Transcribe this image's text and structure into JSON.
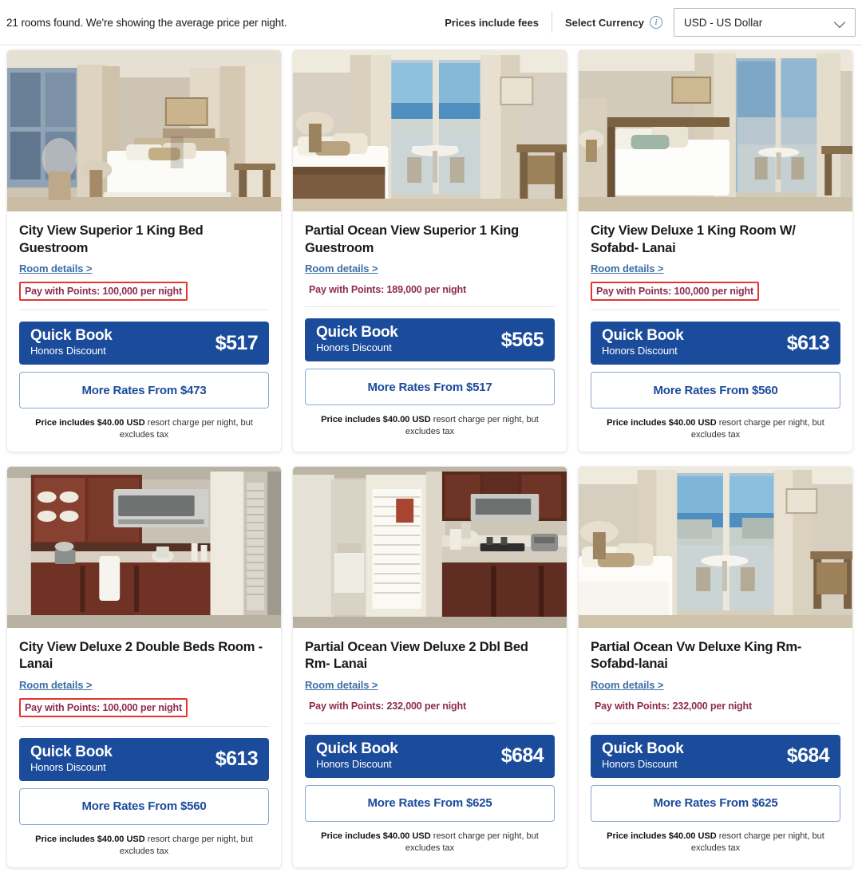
{
  "header": {
    "rooms_found_text": "21 rooms found. We're showing the average price per night.",
    "prices_include_fees": "Prices include fees",
    "select_currency_label": "Select Currency",
    "info_icon": "info-icon",
    "currency_value": "USD - US Dollar",
    "chevron_icon": "chevron-down-icon"
  },
  "labels": {
    "room_details": "Room details >",
    "quick_book": "Quick Book",
    "honors_discount": "Honors Discount",
    "fine_print_bold": "Price includes $40.00 USD",
    "fine_print_rest": " resort charge per night, but excludes tax"
  },
  "colors": {
    "brand_blue": "#1b4b9b",
    "link_blue": "#3d6fa8",
    "points_maroon": "#8e2b52",
    "highlight_red": "#e8342c"
  },
  "cards": [
    {
      "title": "City View Superior 1 King Bed Guestroom",
      "room_details": "Room details >",
      "points": "Pay with Points: 100,000 per night",
      "points_highlighted": true,
      "quick_book_price": "$517",
      "more_rates": "More Rates From $473",
      "image": "city-view-superior-king-bed-room-photo"
    },
    {
      "title": "Partial Ocean View Superior 1 King Guestroom",
      "room_details": "Room details >",
      "points": "Pay with Points: 189,000 per night",
      "points_highlighted": false,
      "quick_book_price": "$565",
      "more_rates": "More Rates From $517",
      "image": "partial-ocean-view-superior-king-room-photo"
    },
    {
      "title": "City View Deluxe 1 King Room W/ Sofabd- Lanai",
      "room_details": "Room details >",
      "points": "Pay with Points: 100,000 per night",
      "points_highlighted": true,
      "quick_book_price": "$613",
      "more_rates": "More Rates From $560",
      "image": "city-view-deluxe-king-room-lanai-photo"
    },
    {
      "title": "City View Deluxe 2 Double Beds Room - Lanai",
      "room_details": "Room details >",
      "points": "Pay with Points: 100,000 per night",
      "points_highlighted": true,
      "quick_book_price": "$613",
      "more_rates": "More Rates From $560",
      "image": "city-view-deluxe-double-beds-kitchenette-photo"
    },
    {
      "title": "Partial Ocean View Deluxe 2 Dbl Bed Rm- Lanai",
      "room_details": "Room details >",
      "points": "Pay with Points: 232,000 per night",
      "points_highlighted": false,
      "quick_book_price": "$684",
      "more_rates": "More Rates From $625",
      "image": "partial-ocean-view-deluxe-kitchen-photo"
    },
    {
      "title": "Partial Ocean Vw Deluxe King Rm- Sofabd-lanai",
      "room_details": "Room details >",
      "points": "Pay with Points: 232,000 per night",
      "points_highlighted": false,
      "quick_book_price": "$684",
      "more_rates": "More Rates From $625",
      "image": "partial-ocean-view-deluxe-king-balcony-photo"
    }
  ]
}
